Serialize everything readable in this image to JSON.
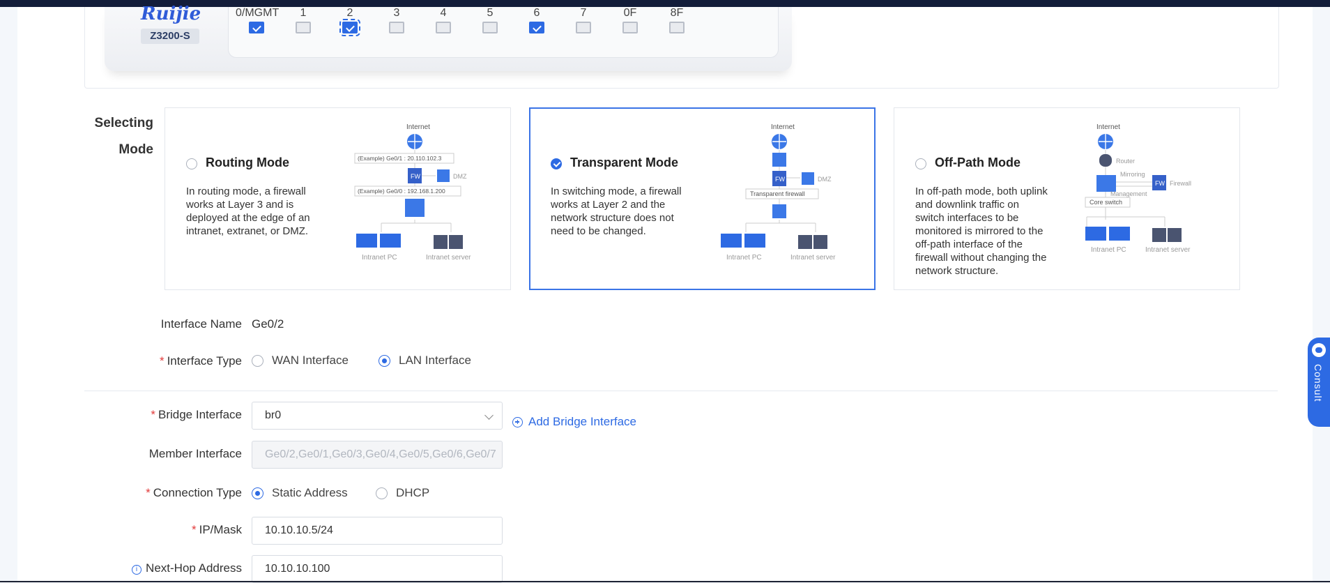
{
  "device": {
    "logo": "Ruijie",
    "model": "Z3200-S",
    "ports": [
      {
        "label": "0/MGMT",
        "checked": true,
        "dashed": false
      },
      {
        "label": "1",
        "checked": false,
        "dashed": false
      },
      {
        "label": "2",
        "checked": true,
        "dashed": true
      },
      {
        "label": "3",
        "checked": false,
        "dashed": false
      },
      {
        "label": "4",
        "checked": false,
        "dashed": false
      },
      {
        "label": "5",
        "checked": false,
        "dashed": false
      },
      {
        "label": "6",
        "checked": true,
        "dashed": false
      },
      {
        "label": "7",
        "checked": false,
        "dashed": false
      },
      {
        "label": "0F",
        "checked": false,
        "dashed": false
      },
      {
        "label": "8F",
        "checked": false,
        "dashed": false
      }
    ]
  },
  "mode": {
    "label_line1": "Selecting",
    "label_line2": "Mode",
    "routing": {
      "title": "Routing Mode",
      "desc": "In routing mode, a firewall works at Layer 3 and is deployed at the edge of an intranet, extranet, or DMZ.",
      "selected": false,
      "diagram": {
        "internet": "Internet",
        "ge01": "(Example) Ge0/1 : 20.110.102.3",
        "fw": "FW",
        "dmz": "DMZ",
        "ge00": "(Example) Ge0/0 : 192.168.1.200",
        "pc": "Intranet PC",
        "server": "Intranet server"
      }
    },
    "transparent": {
      "title": "Transparent Mode",
      "desc": "In switching mode, a firewall works at Layer 2 and the network structure does not need to be changed.",
      "selected": true,
      "diagram": {
        "internet": "Internet",
        "fw": "FW",
        "dmz": "DMZ",
        "tfw": "Transparent firewall",
        "pc": "Intranet PC",
        "server": "Intranet server"
      }
    },
    "offpath": {
      "title": "Off-Path Mode",
      "desc": "In off-path mode, both uplink and downlink traffic on switch interfaces to be monitored is mirrored to the off-path interface of the firewall without changing the network structure.",
      "selected": false,
      "diagram": {
        "internet": "Internet",
        "router": "Router",
        "mirroring": "Mirroring",
        "fw": "FW",
        "firewall": "Firewall",
        "management": "Management",
        "core": "Core switch",
        "pc": "Intranet PC",
        "server": "Intranet server"
      }
    }
  },
  "form": {
    "interface_name": {
      "label": "Interface Name",
      "value": "Ge0/2"
    },
    "interface_type": {
      "label": "Interface Type",
      "wan": "WAN Interface",
      "lan": "LAN Interface",
      "selected": "lan"
    },
    "bridge_interface": {
      "label": "Bridge Interface",
      "value": "br0",
      "add": "Add Bridge Interface"
    },
    "member_interface": {
      "label": "Member Interface",
      "value": "Ge0/2,Ge0/1,Ge0/3,Ge0/4,Ge0/5,Ge0/6,Ge0/7"
    },
    "connection_type": {
      "label": "Connection Type",
      "static": "Static Address",
      "dhcp": "DHCP",
      "selected": "static"
    },
    "ip_mask": {
      "label": "IP/Mask",
      "value": "10.10.10.5/24"
    },
    "next_hop": {
      "label": "Next-Hop Address",
      "value": "10.10.10.100"
    }
  },
  "consult": {
    "label": "Consult"
  },
  "colors": {
    "accent": "#2d6ae3",
    "required": "#e23b3b",
    "topbar": "#131d3a"
  }
}
